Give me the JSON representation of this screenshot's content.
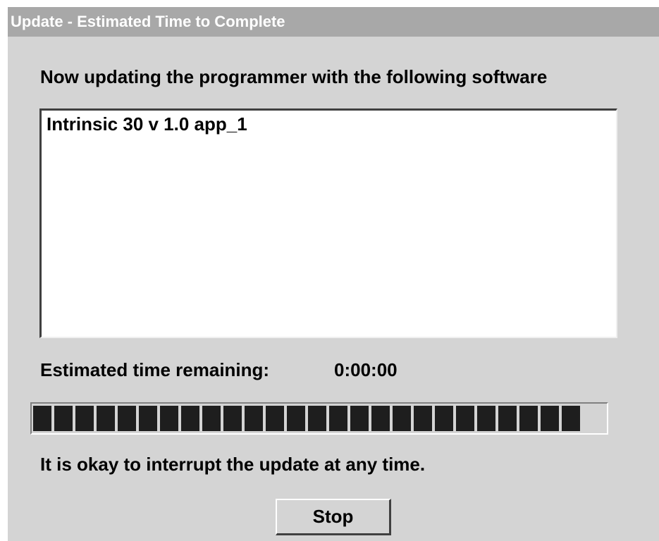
{
  "window": {
    "title": "Update - Estimated Time to Complete"
  },
  "main": {
    "heading": "Now updating the programmer with the following software",
    "software_list": [
      "Intrinsic 30 v 1.0 app_1"
    ],
    "time_remaining_label": "Estimated time remaining:",
    "time_remaining_value": "0:00:00",
    "progress_fraction": 0.95,
    "note": "It is okay to interrupt the update at any time.",
    "stop_label": "Stop"
  },
  "colors": {
    "window_background": "#d4d4d4",
    "titlebar_background": "#a8a8a8",
    "progress_segment": "#1e1e1e"
  }
}
